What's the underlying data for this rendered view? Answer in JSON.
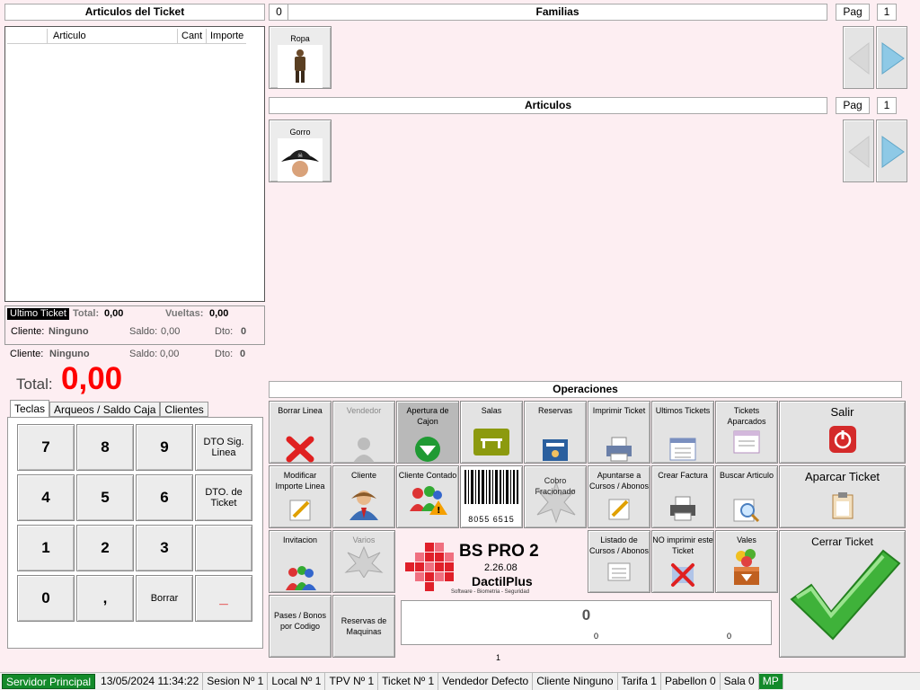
{
  "ticket": {
    "title": "Articulos del Ticket",
    "col_articulo": "Articulo",
    "col_cant": "Cant",
    "col_importe": "Importe"
  },
  "familias": {
    "code": "0",
    "title": "Familias",
    "pag_label": "Pag",
    "pag_value": "1",
    "items": [
      {
        "label": "Ropa"
      }
    ]
  },
  "articulos": {
    "title": "Articulos",
    "pag_label": "Pag",
    "pag_value": "1",
    "items": [
      {
        "label": "Gorro"
      }
    ]
  },
  "summary": {
    "ultimo_ticket": "Ultimo Ticket",
    "total_label": "Total:",
    "total_value": "0,00",
    "vueltas_label": "Vueltas:",
    "vueltas_value": "0,00",
    "cliente_label": "Cliente:",
    "cliente_value": "Ninguno",
    "saldo_label": "Saldo:",
    "saldo_value": "0,00",
    "dto_label": "Dto:",
    "dto_value": "0"
  },
  "current_client": {
    "cliente_label": "Cliente:",
    "cliente_value": "Ninguno",
    "saldo_label": "Saldo:",
    "saldo_value": "0,00",
    "dto_label": "Dto:",
    "dto_value": "0"
  },
  "total": {
    "label": "Total:",
    "value": "0,00",
    "color": "#ff0000"
  },
  "tabs": [
    "Teclas",
    "Arqueos / Saldo Caja",
    "Clientes"
  ],
  "keypad": {
    "k7": "7",
    "k8": "8",
    "k9": "9",
    "dto_sig": "DTO Sig. Linea",
    "k4": "4",
    "k5": "5",
    "k6": "6",
    "dto_ticket": "DTO. de Ticket",
    "k1": "1",
    "k2": "2",
    "k3": "3",
    "k0": "0",
    "comma": ",",
    "borrar": "Borrar",
    "minus": "_"
  },
  "operaciones": {
    "title": "Operaciones",
    "borrar_linea": "Borrar Linea",
    "vendedor": "Vendedor",
    "apertura_cajon": "Apertura de Cajon",
    "salas": "Salas",
    "reservas": "Reservas",
    "imprimir_ticket": "Imprimir Ticket",
    "ultimos_tickets": "Ultimos Tickets",
    "tickets_aparcados": "Tickets Aparcados",
    "salir": "Salir",
    "modificar_importe": "Modificar Importe Linea",
    "cliente": "Cliente",
    "cliente_contado": "Cliente Contado",
    "barcode_number": "8055 6515",
    "cobro_fraccionado": "Cobro Fracionado",
    "apuntarse_cursos": "Apuntarse a Cursos / Abonos",
    "crear_factura": "Crear Factura",
    "buscar_articulo": "Buscar Articulo",
    "aparcar_ticket": "Aparcar Ticket",
    "invitacion": "Invitacion",
    "varios": "Varios",
    "listado_cursos": "Listado de Cursos / Abonos",
    "no_imprimir": "NO imprimir este Ticket",
    "vales": "Vales",
    "cerrar_ticket": "Cerrar Ticket",
    "pases_bonos": "Pases / Bonos por Codigo",
    "reservas_maquinas": "Reservas de Maquinas"
  },
  "brand": {
    "name": "BS PRO 2",
    "version": "2.26.08",
    "company": "DactilPlus",
    "tagline": "Software - Biometria - Seguridad"
  },
  "display": {
    "main": "0",
    "left": "0",
    "right": "0"
  },
  "page_number": "1",
  "status": {
    "server": "Servidor Principal",
    "datetime": "13/05/2024 11:34:22",
    "sesion": "Sesion Nº   1",
    "local": "Local Nº   1",
    "tpv": "TPV Nº   1",
    "ticket": "Ticket Nº   1",
    "vendedor": "Vendedor   Defecto",
    "cliente": "Cliente   Ninguno",
    "tarifa": "Tarifa   1",
    "pabellon": "Pabellon   0",
    "sala": "Sala   0",
    "mp": "MP"
  }
}
